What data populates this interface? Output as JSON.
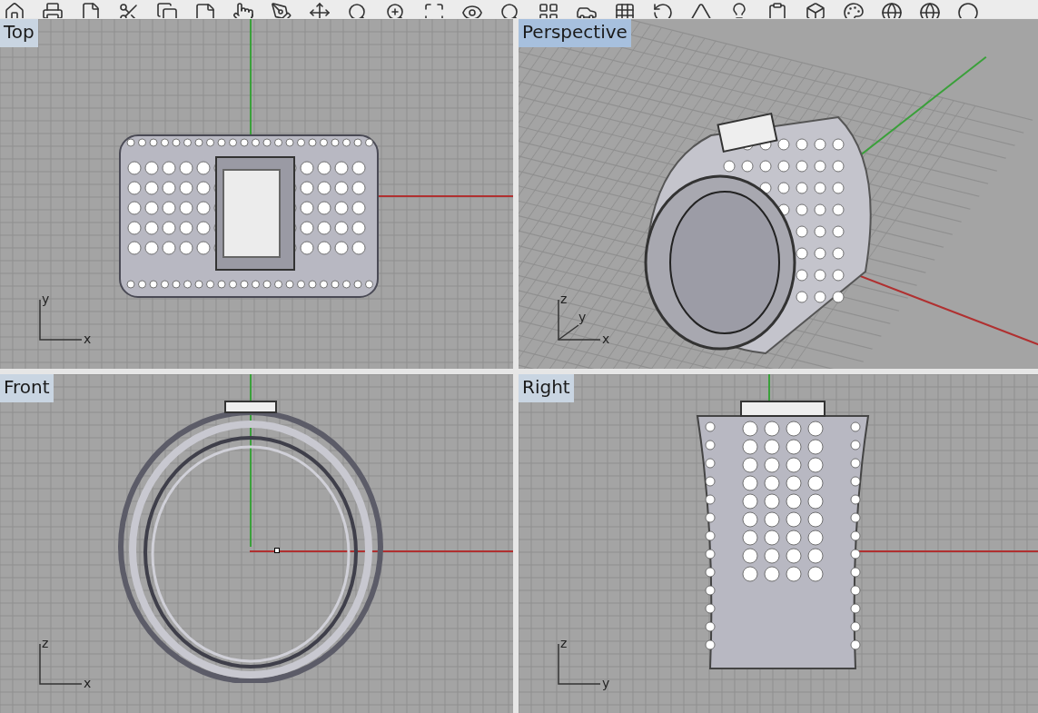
{
  "viewports": [
    {
      "kind": "top",
      "title": "Top",
      "selected": false,
      "axis_labels": {
        "vertical": "y",
        "horizontal": "x"
      }
    },
    {
      "kind": "perspective",
      "title": "Perspective",
      "selected": true,
      "axis_labels": {
        "vertical": "z",
        "depth": "y",
        "horizontal": "x"
      }
    },
    {
      "kind": "front",
      "title": "Front",
      "selected": false,
      "axis_labels": {
        "vertical": "z",
        "horizontal": "x"
      }
    },
    {
      "kind": "right",
      "title": "Right",
      "selected": false,
      "axis_labels": {
        "vertical": "z",
        "horizontal": "y"
      }
    }
  ]
}
